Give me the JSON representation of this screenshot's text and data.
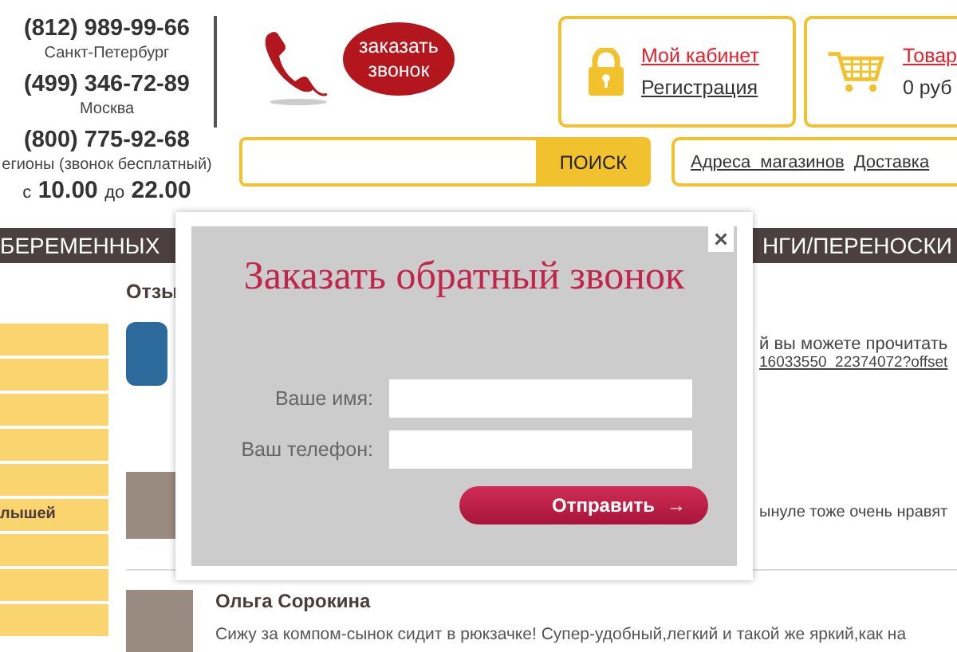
{
  "header": {
    "phones": [
      {
        "number": "(812) 989-99-66",
        "city": "Санкт-Петербург"
      },
      {
        "number": "(499) 346-72-89",
        "city": "Москва"
      },
      {
        "number": "(800) 775-92-68",
        "city": "егионы (звонок бесплатный)"
      }
    ],
    "hours": {
      "from_word": "с",
      "from": "10.00",
      "to_word": "до",
      "to": "22.00"
    },
    "callback_button": "заказать звонок",
    "account": {
      "login": "Мой кабинет",
      "register": "Регистрация"
    },
    "cart": {
      "title": "Товар",
      "sum": "0 руб"
    },
    "search": {
      "button": "ПОИСК"
    },
    "links": [
      "Адреса магазинов",
      "Доставка"
    ]
  },
  "nav": [
    "БЕРЕМЕННЫХ",
    "НГИ/ПЕРЕНОСКИ"
  ],
  "sidebar": {
    "label": "лышей"
  },
  "reviews": {
    "heading": "Отзы",
    "intro": "й вы можете прочитать",
    "link": "16033550_22374072?offset",
    "first_text": "ынуле тоже очень нравят",
    "items": [
      {
        "name": "Ольга Сорокина",
        "text": "Сижу за компом-сынок сидит в рюкзачке! Супер-удобный,легкий и такой же яркий,как на"
      }
    ]
  },
  "modal": {
    "title": "Заказать обратный звонок",
    "close": "×",
    "fields": [
      {
        "label": "Ваше имя:"
      },
      {
        "label": "Ваш телефон:"
      }
    ],
    "submit": "Отправить",
    "submit_arrow": "→"
  }
}
